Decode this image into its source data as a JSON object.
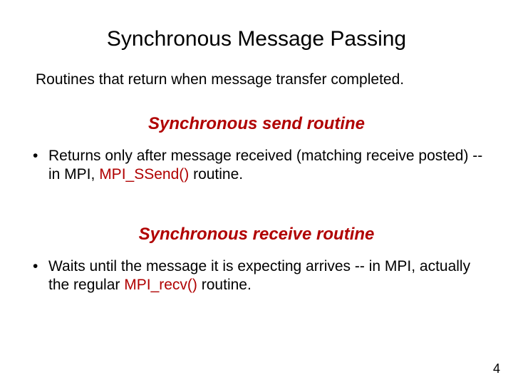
{
  "title": "Synchronous Message Passing",
  "intro": "Routines that return when message transfer completed.",
  "section1": {
    "heading": "Synchronous send routine",
    "bullet_pre": "Returns only after message received (matching receive posted) -- in MPI, ",
    "bullet_code": "MPI_SSend()",
    "bullet_post": " routine."
  },
  "section2": {
    "heading": "Synchronous receive routine",
    "bullet_pre": "Waits until the message it is expecting arrives -- in MPI, actually the regular ",
    "bullet_code": "MPI_recv()",
    "bullet_post": " routine."
  },
  "page_number": "4"
}
